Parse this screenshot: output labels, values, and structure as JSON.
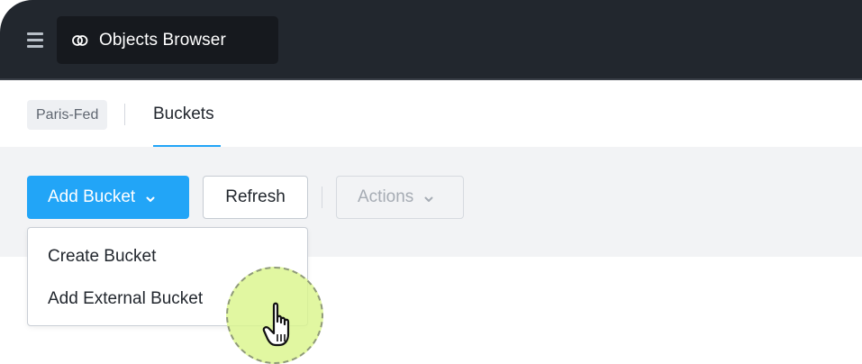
{
  "header": {
    "menu_icon": "hamburger-menu-icon",
    "app_icon": "objects-browser-icon",
    "app_title": "Objects Browser"
  },
  "breadcrumb": {
    "cluster": "Paris-Fed",
    "tabs": [
      {
        "label": "Buckets",
        "active": true
      }
    ]
  },
  "toolbar": {
    "add_bucket_label": "Add Bucket",
    "refresh_label": "Refresh",
    "actions_label": "Actions",
    "actions_disabled": true
  },
  "add_bucket_menu": {
    "open": true,
    "items": [
      {
        "label": "Create Bucket"
      },
      {
        "label": "Add External Bucket"
      }
    ]
  },
  "cursor": {
    "icon": "hand-pointer-icon",
    "highlight": true
  },
  "colors": {
    "topbar": "#22272e",
    "accent": "#22a5f7",
    "cursor_halo": "#daf58c"
  }
}
